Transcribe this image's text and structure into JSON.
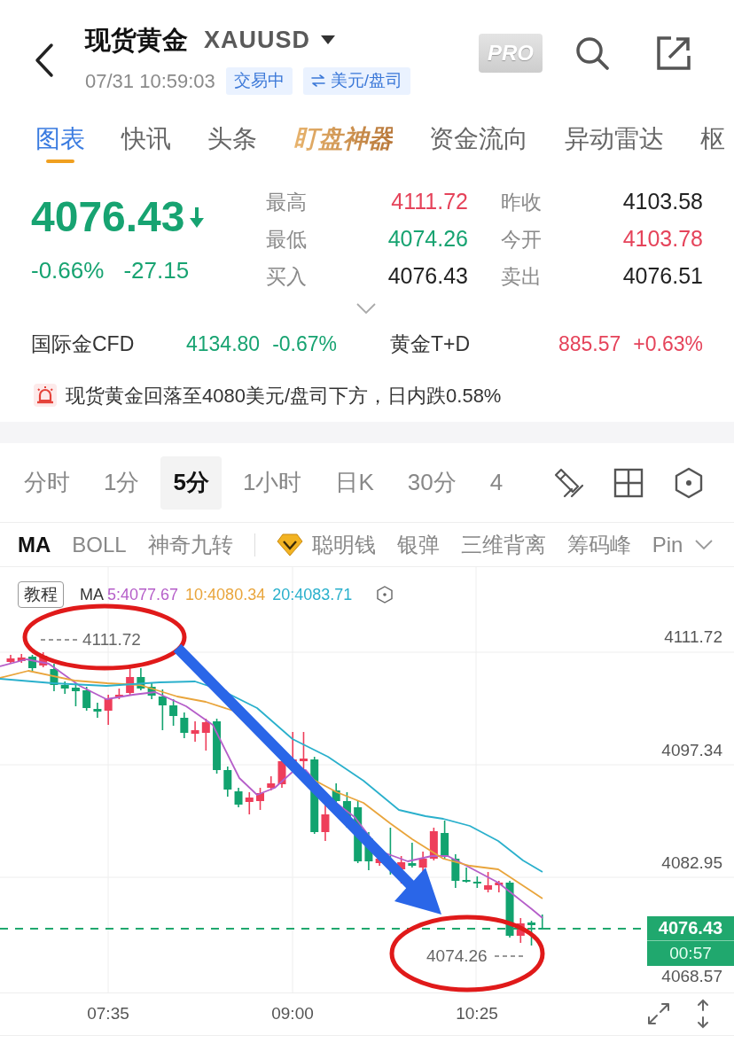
{
  "header": {
    "name": "现货黄金",
    "code": "XAUUSD",
    "timestamp": "07/31 10:59:03",
    "status": "交易中",
    "unit": "美元/盘司",
    "pro_label": "PRO"
  },
  "tabs": [
    {
      "label": "图表",
      "selected": true,
      "kind": "normal"
    },
    {
      "label": "快讯",
      "selected": false,
      "kind": "normal"
    },
    {
      "label": "头条",
      "selected": false,
      "kind": "normal"
    },
    {
      "label": "盯盘神器",
      "selected": false,
      "kind": "promo"
    },
    {
      "label": "资金流向",
      "selected": false,
      "kind": "normal"
    },
    {
      "label": "异动雷达",
      "selected": false,
      "kind": "normal"
    },
    {
      "label": "枢",
      "selected": false,
      "kind": "normal"
    }
  ],
  "quote": {
    "price": "4076.43",
    "falling": true,
    "change_percent": "-0.66%",
    "change": "-27.15",
    "stats": [
      {
        "label": "最高",
        "value": "4111.72",
        "color": "#e5435a"
      },
      {
        "label": "昨收",
        "value": "4103.58",
        "color": "#222222"
      },
      {
        "label": "最低",
        "value": "4074.26",
        "color": "#17a371"
      },
      {
        "label": "今开",
        "value": "4103.78",
        "color": "#e5435a"
      },
      {
        "label": "买入",
        "value": "4076.43",
        "color": "#222222"
      },
      {
        "label": "卖出",
        "value": "4076.51",
        "color": "#222222"
      }
    ]
  },
  "related": [
    {
      "name": "国际金CFD",
      "price": "4134.80",
      "change": "-0.67%",
      "color": "#17a371"
    },
    {
      "name": "黄金T+D",
      "price": "885.57",
      "change": "+0.63%",
      "color": "#e5435a"
    }
  ],
  "alert": {
    "text": "现货黄金回落至4080美元/盘司下方，日内跌0.58%"
  },
  "periods": [
    {
      "label": "分时",
      "selected": false
    },
    {
      "label": "1分",
      "selected": false
    },
    {
      "label": "5分",
      "selected": true
    },
    {
      "label": "1小时",
      "selected": false
    },
    {
      "label": "日K",
      "selected": false
    },
    {
      "label": "30分",
      "selected": false
    },
    {
      "label": "4",
      "selected": false
    }
  ],
  "indicators": {
    "main": [
      {
        "label": "MA",
        "selected": true
      },
      {
        "label": "BOLL",
        "selected": false
      },
      {
        "label": "神奇九转",
        "selected": false
      }
    ],
    "extra": [
      {
        "label": "聪明钱",
        "selected": false,
        "kind": "premium"
      },
      {
        "label": "银弹",
        "selected": false,
        "kind": "plain"
      },
      {
        "label": "三维背离",
        "selected": false,
        "kind": "plain"
      },
      {
        "label": "筹码峰",
        "selected": false,
        "kind": "plain"
      },
      {
        "label": "Pin",
        "selected": false,
        "kind": "plain"
      }
    ]
  },
  "chart": {
    "tutorial_label": "教程",
    "legend": {
      "label": "MA",
      "series": [
        {
          "text": "5:4077.67",
          "color": "#b55ec9"
        },
        {
          "text": "10:4080.34",
          "color": "#e9a53c"
        },
        {
          "text": "20:4083.71",
          "color": "#2ab0cc"
        }
      ]
    },
    "high_marker": "4111.72",
    "low_marker": "4074.26",
    "y_axis_labels": [
      "4111.72",
      "4097.34",
      "4082.95",
      "4068.57"
    ],
    "price_tag": {
      "price": "4076.43",
      "countdown": "00:57"
    },
    "x_axis_labels": [
      "07:35",
      "09:00",
      "10:25"
    ]
  }
}
